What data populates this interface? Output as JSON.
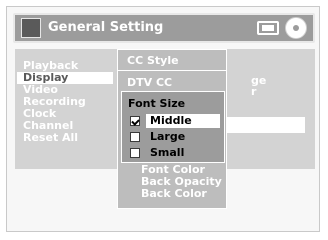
{
  "window": {
    "title": "General Setting"
  },
  "icons": {
    "wrench": "wrench-icon",
    "tv": "tv-icon",
    "disc": "disc-icon",
    "arrow": "arrow-right-icon"
  },
  "left_menu": {
    "items": [
      {
        "label": "Playback"
      },
      {
        "label": "Display",
        "selected": true
      },
      {
        "label": "Video"
      },
      {
        "label": "Recording"
      },
      {
        "label": "Clock"
      },
      {
        "label": "Channel"
      },
      {
        "label": "Reset All"
      }
    ]
  },
  "right_peek": {
    "line1": "ge",
    "line2": "r"
  },
  "cc_menu": {
    "title": "CC Style",
    "item_dtv": "DTV CC",
    "lower_items": [
      "Font Color",
      "Back Opacity",
      "Back Color"
    ]
  },
  "font_size": {
    "title": "Font Size",
    "options": [
      {
        "label": "Middle",
        "checked": true
      },
      {
        "label": "Large",
        "checked": false
      },
      {
        "label": "Small",
        "checked": false
      }
    ]
  },
  "colors": {
    "title_bar": "#9c9c9c",
    "panel": "#d3d3d3",
    "submenu": "#bdbdbd",
    "popup": "#9c9c9c",
    "highlight": "#ffffff"
  }
}
